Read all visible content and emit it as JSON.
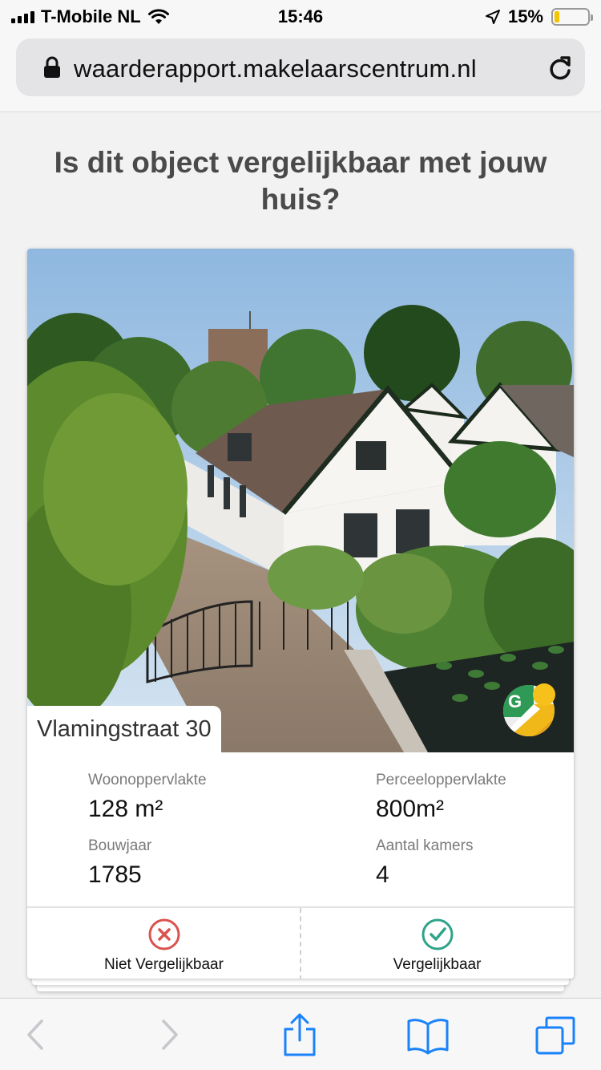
{
  "status_bar": {
    "carrier": "T-Mobile NL",
    "time": "15:46",
    "battery": "15%",
    "battery_level": 0.15
  },
  "browser": {
    "url": "waarderapport.makelaarscentrum.nl"
  },
  "page": {
    "title": "Is dit object vergelijkbaar met jouw huis?"
  },
  "property": {
    "address": "Vlamingstraat 30",
    "specs": [
      {
        "label": "Woonoppervlakte",
        "value": "128 m²"
      },
      {
        "label": "Perceeloppervlakte",
        "value": "800m²"
      },
      {
        "label": "Bouwjaar",
        "value": "1785"
      },
      {
        "label": "Aantal kamers",
        "value": "4"
      }
    ]
  },
  "actions": {
    "not_comparable": "Niet Vergelijkbaar",
    "comparable": "Vergelijkbaar"
  },
  "colors": {
    "reject": "#d9534f",
    "accept": "#2fa38a",
    "ios_blue": "#1a82fb",
    "title_gray": "#4a4a4a"
  }
}
